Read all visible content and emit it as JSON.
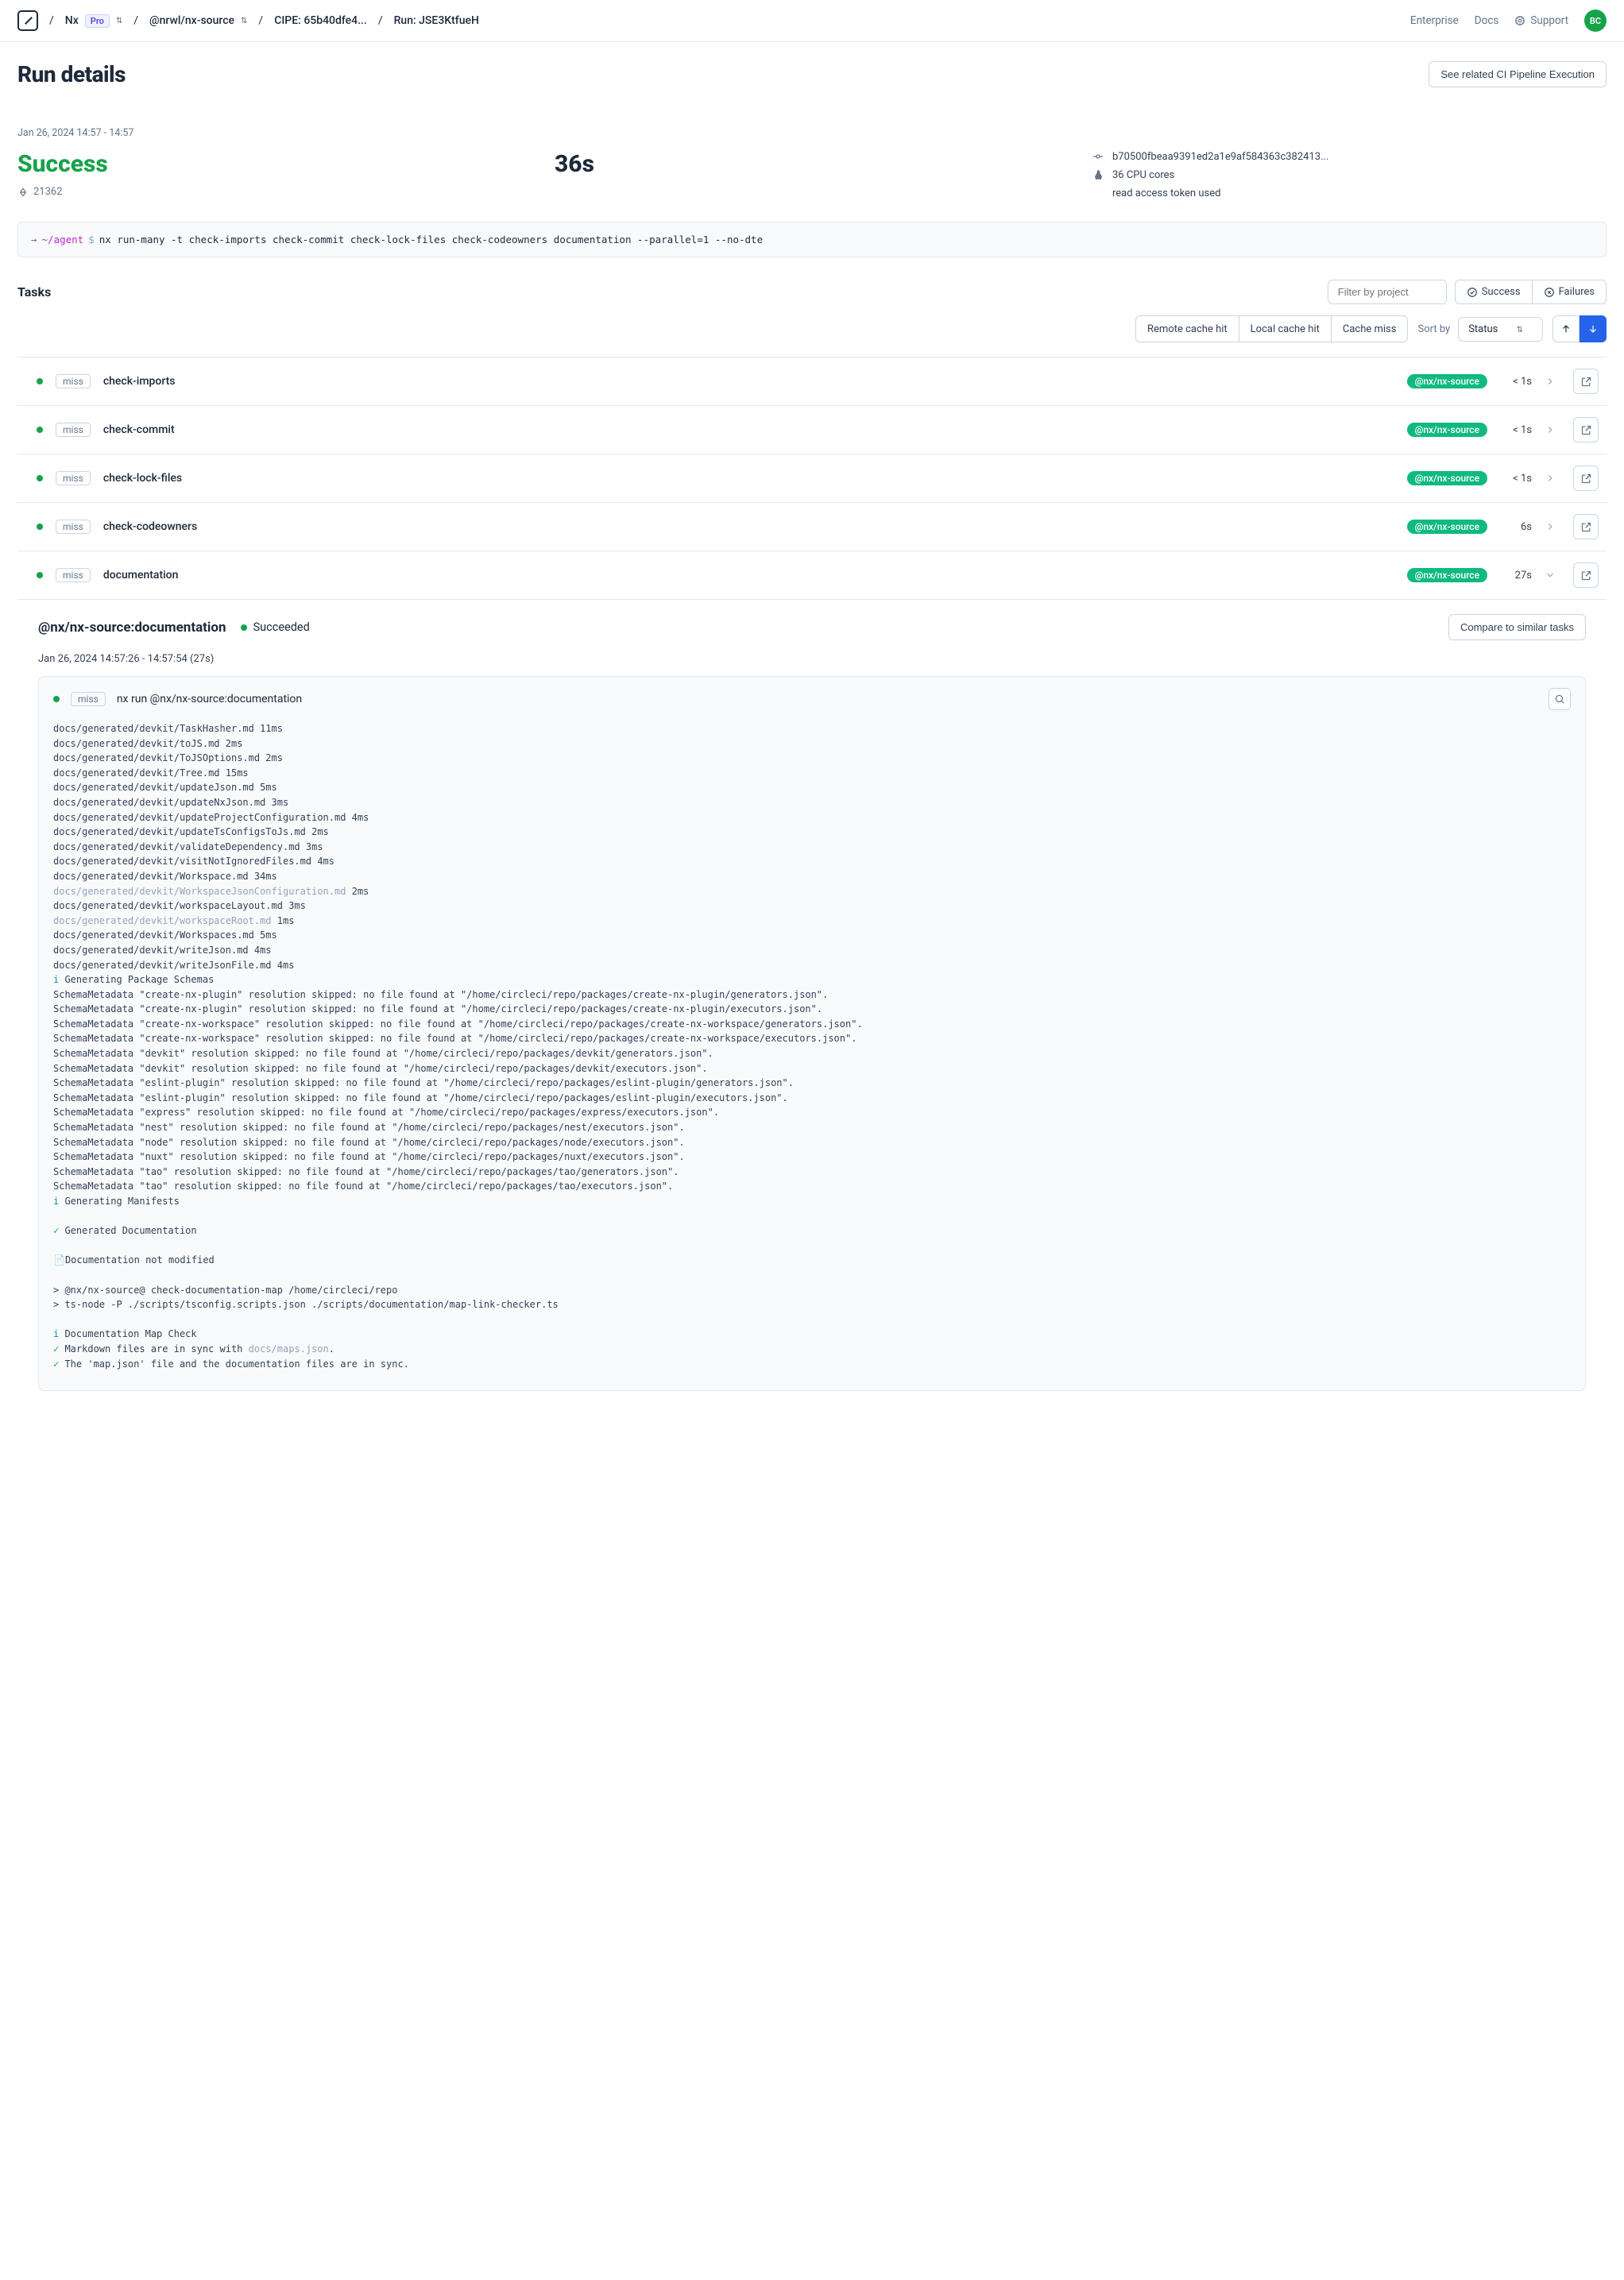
{
  "header": {
    "org": "Nx",
    "badge": "Pro",
    "workspace": "@nrwl/nx-source",
    "cipe_label": "CIPE: 65b40dfe4...",
    "run_label": "Run: JSE3KtfueH",
    "links": {
      "enterprise": "Enterprise",
      "docs": "Docs",
      "support": "Support"
    },
    "avatar": "BC"
  },
  "page": {
    "title": "Run details",
    "related_btn": "See related CI Pipeline Execution",
    "timestamp": "Jan 26, 2024 14:57 - 14:57",
    "status": "Success",
    "task_count": "21362",
    "duration": "36s",
    "commit_sha": "b70500fbeaa9391ed2a1e9af584363c382413...",
    "cpu": "36 CPU cores",
    "token": "read access token used",
    "cmd_path": "~/agent",
    "cmd": "nx run-many -t check-imports check-commit check-lock-files check-codeowners documentation --parallel=1 --no-dte"
  },
  "tasks": {
    "title": "Tasks",
    "filter_placeholder": "Filter by project",
    "success_label": "Success",
    "failures_label": "Failures",
    "cache_filters": [
      "Remote cache hit",
      "Local cache hit",
      "Cache miss"
    ],
    "sort_label": "Sort by",
    "sort_value": "Status",
    "rows": [
      {
        "cache": "miss",
        "name": "check-imports",
        "project": "@nx/nx-source",
        "time": "< 1s",
        "expanded": false
      },
      {
        "cache": "miss",
        "name": "check-commit",
        "project": "@nx/nx-source",
        "time": "< 1s",
        "expanded": false
      },
      {
        "cache": "miss",
        "name": "check-lock-files",
        "project": "@nx/nx-source",
        "time": "< 1s",
        "expanded": false
      },
      {
        "cache": "miss",
        "name": "check-codeowners",
        "project": "@nx/nx-source",
        "time": "6s",
        "expanded": false
      },
      {
        "cache": "miss",
        "name": "documentation",
        "project": "@nx/nx-source",
        "time": "27s",
        "expanded": true
      }
    ]
  },
  "detail": {
    "title": "@nx/nx-source:documentation",
    "status": "Succeeded",
    "compare_btn": "Compare to similar tasks",
    "time_range": "Jan 26, 2024 14:57:26 - 14:57:54 (27s)",
    "cache": "miss",
    "cmd": "nx run @nx/nx-source:documentation",
    "log_lines": [
      {
        "t": "docs/generated/devkit/TaskHasher.md 11ms"
      },
      {
        "t": "docs/generated/devkit/toJS.md 2ms"
      },
      {
        "t": "docs/generated/devkit/ToJSOptions.md 2ms"
      },
      {
        "t": "docs/generated/devkit/Tree.md 15ms"
      },
      {
        "t": "docs/generated/devkit/updateJson.md 5ms"
      },
      {
        "t": "docs/generated/devkit/updateNxJson.md 3ms"
      },
      {
        "t": "docs/generated/devkit/updateProjectConfiguration.md 4ms"
      },
      {
        "t": "docs/generated/devkit/updateTsConfigsToJs.md 2ms"
      },
      {
        "t": "docs/generated/devkit/validateDependency.md 3ms"
      },
      {
        "t": "docs/generated/devkit/visitNotIgnoredFiles.md 4ms"
      },
      {
        "t": "docs/generated/devkit/Workspace.md 34ms"
      },
      {
        "t": "docs/generated/devkit/WorkspaceJsonConfiguration.md",
        "c": "gray",
        "s": " 2ms"
      },
      {
        "t": "docs/generated/devkit/workspaceLayout.md 3ms"
      },
      {
        "t": "docs/generated/devkit/workspaceRoot.md",
        "c": "gray",
        "s": " 1ms"
      },
      {
        "t": "docs/generated/devkit/Workspaces.md 5ms"
      },
      {
        "t": "docs/generated/devkit/writeJson.md 4ms"
      },
      {
        "t": "docs/generated/devkit/writeJsonFile.md 4ms"
      },
      {
        "p": "i ",
        "pc": "cyan",
        "t": "Generating Package Schemas"
      },
      {
        "t": "SchemaMetadata \"create-nx-plugin\" resolution skipped: no file found at \"/home/circleci/repo/packages/create-nx-plugin/generators.json\"."
      },
      {
        "t": "SchemaMetadata \"create-nx-plugin\" resolution skipped: no file found at \"/home/circleci/repo/packages/create-nx-plugin/executors.json\"."
      },
      {
        "t": "SchemaMetadata \"create-nx-workspace\" resolution skipped: no file found at \"/home/circleci/repo/packages/create-nx-workspace/generators.json\"."
      },
      {
        "t": "SchemaMetadata \"create-nx-workspace\" resolution skipped: no file found at \"/home/circleci/repo/packages/create-nx-workspace/executors.json\"."
      },
      {
        "t": "SchemaMetadata \"devkit\" resolution skipped: no file found at \"/home/circleci/repo/packages/devkit/generators.json\"."
      },
      {
        "t": "SchemaMetadata \"devkit\" resolution skipped: no file found at \"/home/circleci/repo/packages/devkit/executors.json\"."
      },
      {
        "t": "SchemaMetadata \"eslint-plugin\" resolution skipped: no file found at \"/home/circleci/repo/packages/eslint-plugin/generators.json\"."
      },
      {
        "t": "SchemaMetadata \"eslint-plugin\" resolution skipped: no file found at \"/home/circleci/repo/packages/eslint-plugin/executors.json\"."
      },
      {
        "t": "SchemaMetadata \"express\" resolution skipped: no file found at \"/home/circleci/repo/packages/express/executors.json\"."
      },
      {
        "t": "SchemaMetadata \"nest\" resolution skipped: no file found at \"/home/circleci/repo/packages/nest/executors.json\"."
      },
      {
        "t": "SchemaMetadata \"node\" resolution skipped: no file found at \"/home/circleci/repo/packages/node/executors.json\"."
      },
      {
        "t": "SchemaMetadata \"nuxt\" resolution skipped: no file found at \"/home/circleci/repo/packages/nuxt/executors.json\"."
      },
      {
        "t": "SchemaMetadata \"tao\" resolution skipped: no file found at \"/home/circleci/repo/packages/tao/generators.json\"."
      },
      {
        "t": "SchemaMetadata \"tao\" resolution skipped: no file found at \"/home/circleci/repo/packages/tao/executors.json\"."
      },
      {
        "p": "i ",
        "pc": "cyan",
        "t": "Generating Manifests"
      },
      {
        "t": ""
      },
      {
        "p": "✓ ",
        "pc": "green",
        "t": "Generated Documentation"
      },
      {
        "t": ""
      },
      {
        "t": "📄Documentation not modified"
      },
      {
        "t": ""
      },
      {
        "t": "> @nx/nx-source@ check-documentation-map /home/circleci/repo"
      },
      {
        "t": "> ts-node -P ./scripts/tsconfig.scripts.json ./scripts/documentation/map-link-checker.ts"
      },
      {
        "t": ""
      },
      {
        "p": "i ",
        "pc": "cyan",
        "t": "Documentation Map Check"
      },
      {
        "p": "✓ ",
        "pc": "green",
        "t": "Markdown files are in sync with ",
        "s": "docs/maps.json",
        "sc": "gray",
        "e": "."
      },
      {
        "p": "✓ ",
        "pc": "green",
        "t": "The 'map.json' file and the documentation files are in sync."
      }
    ]
  }
}
